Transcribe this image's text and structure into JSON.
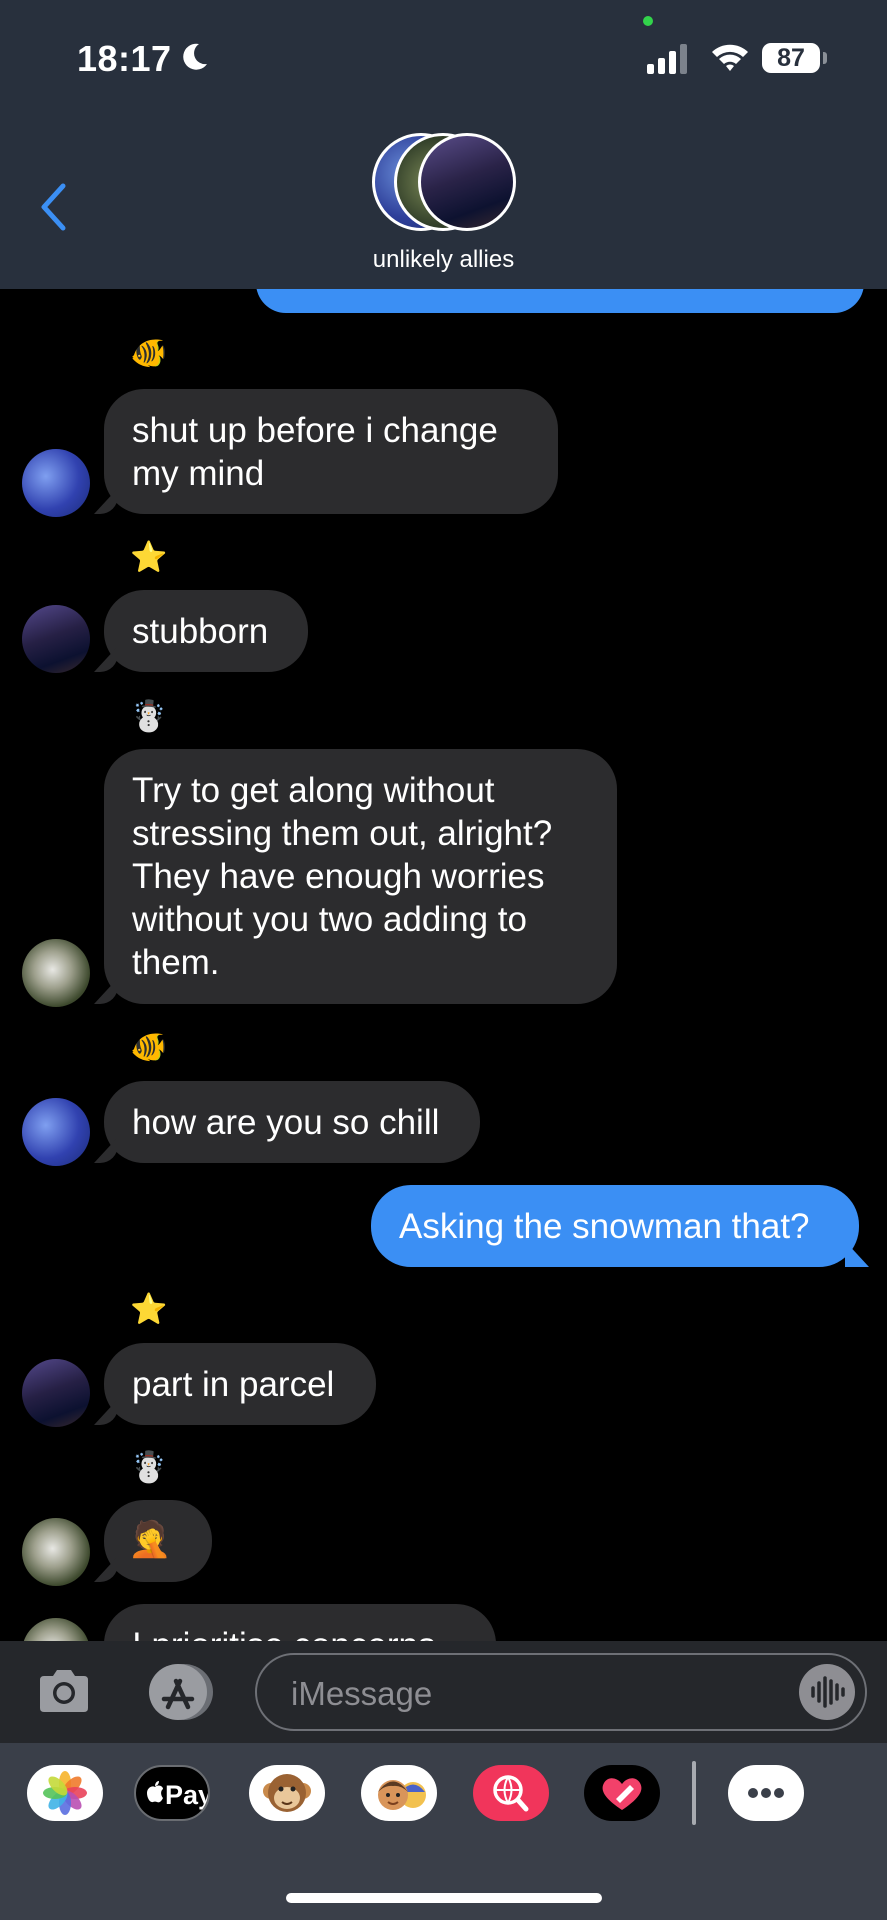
{
  "status_bar": {
    "time": "18:17",
    "battery": "87"
  },
  "conversation": {
    "name": "unlikely allies"
  },
  "messages": [
    {
      "sender": "fish",
      "icon": "🐠",
      "text": "shut up before i change my mind"
    },
    {
      "sender": "star",
      "icon": "⭐",
      "text": "stubborn"
    },
    {
      "sender": "snowman",
      "icon": "☃️",
      "text": "Try to get along without stressing them out, alright? They have enough worries without you two adding to them."
    },
    {
      "sender": "fish",
      "icon": "🐠",
      "text": "how are you so chill"
    },
    {
      "sender": "me",
      "text": "Asking the snowman that?"
    },
    {
      "sender": "star",
      "icon": "⭐",
      "text": "part in parcel"
    },
    {
      "sender": "snowman",
      "icon": "☃️",
      "text": "🤦"
    },
    {
      "sender": "snowman",
      "text": "I prioritise concerns"
    }
  ],
  "compose": {
    "placeholder": "iMessage"
  },
  "app_tray": {
    "apple_pay_label": "Pay"
  }
}
